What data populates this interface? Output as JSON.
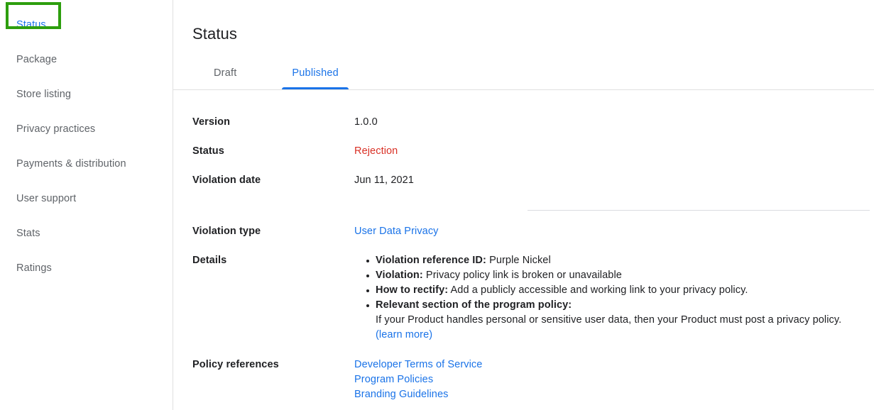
{
  "sidebar": {
    "items": [
      {
        "label": "Status",
        "active": true
      },
      {
        "label": "Package",
        "active": false
      },
      {
        "label": "Store listing",
        "active": false
      },
      {
        "label": "Privacy practices",
        "active": false
      },
      {
        "label": "Payments & distribution",
        "active": false
      },
      {
        "label": "User support",
        "active": false
      },
      {
        "label": "Stats",
        "active": false
      },
      {
        "label": "Ratings",
        "active": false
      }
    ],
    "annotation_color": "#2d9e0e"
  },
  "main": {
    "title": "Status",
    "tabs": [
      {
        "label": "Draft",
        "active": false
      },
      {
        "label": "Published",
        "active": true
      }
    ],
    "active_tab_color": "#1a73e8",
    "fields": {
      "version_label": "Version",
      "version_value": "1.0.0",
      "status_label": "Status",
      "status_value": "Rejection",
      "status_color": "#d93025",
      "violation_date_label": "Violation date",
      "violation_date_value": "Jun 11, 2021",
      "violation_type_label": "Violation type",
      "violation_type_value": "User Data Privacy",
      "details_label": "Details",
      "policy_references_label": "Policy references"
    },
    "details": [
      {
        "term": "Violation reference ID:",
        "text": " Purple Nickel"
      },
      {
        "term": "Violation:",
        "text": " Privacy policy link is broken or unavailable"
      },
      {
        "term": "How to rectify:",
        "text": " Add a publicly accessible and working link to your privacy policy."
      },
      {
        "term": "Relevant section of the program policy:",
        "text": ""
      }
    ],
    "details_subtext": "If your Product handles personal or sensitive user data, then your Product must post a privacy policy.",
    "details_learn_more": "(learn more)",
    "policy_references": [
      "Developer Terms of Service",
      "Program Policies",
      "Branding Guidelines"
    ]
  }
}
